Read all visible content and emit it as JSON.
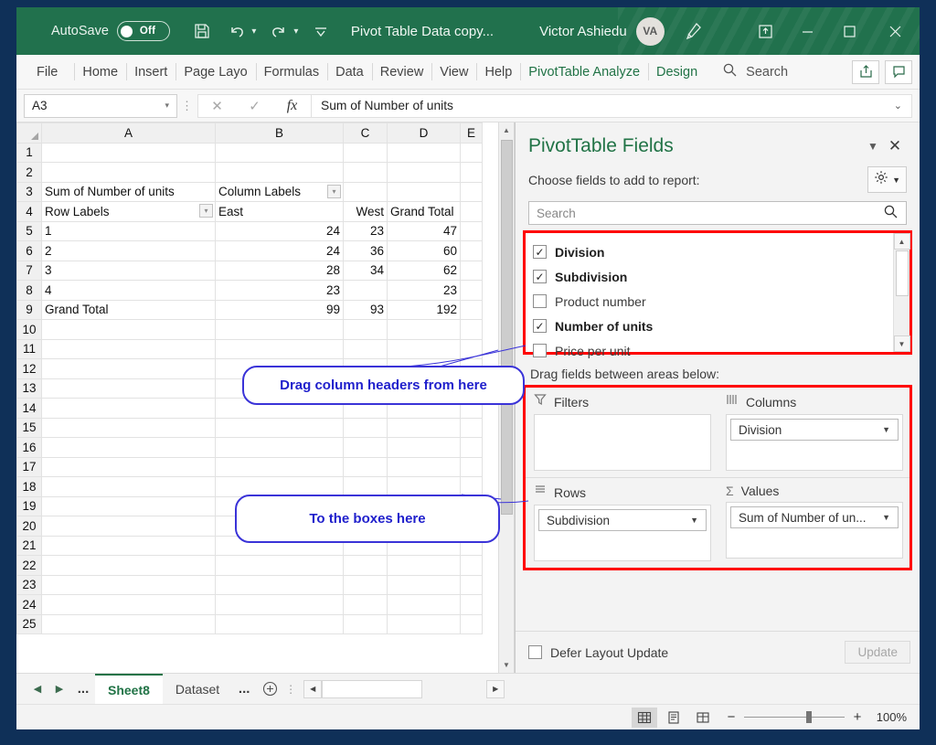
{
  "titlebar": {
    "autosave_label": "AutoSave",
    "autosave_state": "Off",
    "document_title": "Pivot Table Data copy...",
    "user_name": "Victor Ashiedu",
    "user_initials": "VA",
    "icons": [
      "save-icon",
      "undo-icon",
      "redo-icon",
      "customize-quick-access-icon",
      "pen-icon",
      "restore-down-window-icon"
    ],
    "window_buttons": [
      "minimize",
      "maximize",
      "close"
    ],
    "bg_color": "#21714d"
  },
  "ribbon": {
    "tabs": [
      {
        "label": "File",
        "contextual": false
      },
      {
        "label": "Home",
        "contextual": false
      },
      {
        "label": "Insert",
        "contextual": false
      },
      {
        "label": "Page Layo",
        "contextual": false
      },
      {
        "label": "Formulas",
        "contextual": false
      },
      {
        "label": "Data",
        "contextual": false
      },
      {
        "label": "Review",
        "contextual": false
      },
      {
        "label": "View",
        "contextual": false
      },
      {
        "label": "Help",
        "contextual": false
      },
      {
        "label": "PivotTable Analyze",
        "contextual": true
      },
      {
        "label": "Design",
        "contextual": true
      }
    ],
    "search_label": "Search",
    "share_icon": "share-icon",
    "comments_icon": "comments-icon",
    "contextual_color": "#217346"
  },
  "formula_bar": {
    "name_box_value": "A3",
    "cancel_icon": "cancel-x-icon",
    "enter_icon": "enter-check-icon",
    "function_icon": "fx-icon",
    "formula_value": "Sum of Number of units"
  },
  "grid": {
    "column_headers": [
      "A",
      "B",
      "C",
      "D",
      "E"
    ],
    "row_numbers": [
      1,
      2,
      3,
      4,
      5,
      6,
      7,
      8,
      9,
      10,
      11,
      12,
      13,
      14,
      15,
      16,
      17,
      18,
      19,
      20,
      21,
      22,
      23,
      24,
      25
    ],
    "cells": {
      "A3": "Sum of Number of units",
      "B3": "Column Labels",
      "A4": "Row Labels",
      "B4": "East",
      "C4": "West",
      "D4": "Grand Total",
      "rows": [
        {
          "label": "1",
          "east": "24",
          "west": "23",
          "total": "47"
        },
        {
          "label": "2",
          "east": "24",
          "west": "36",
          "total": "60"
        },
        {
          "label": "3",
          "east": "28",
          "west": "34",
          "total": "62"
        },
        {
          "label": "4",
          "east": "23",
          "west": "",
          "total": "23"
        },
        {
          "label": "Grand Total",
          "east": "99",
          "west": "93",
          "total": "192"
        }
      ]
    }
  },
  "callouts": [
    {
      "text": "Drag column headers from here"
    },
    {
      "text": "To the boxes here"
    }
  ],
  "pivot_pane": {
    "title": "PivotTable Fields",
    "menu_icon": "chevron-down-icon",
    "close_icon": "close-icon",
    "choose_label": "Choose fields to add to report:",
    "tools_icon": "gear-icon",
    "search_placeholder": "Search",
    "search_icon": "search-icon",
    "fields": [
      {
        "label": "Division",
        "checked": true
      },
      {
        "label": "Subdivision",
        "checked": true
      },
      {
        "label": "Product number",
        "checked": false
      },
      {
        "label": "Number of units",
        "checked": true
      },
      {
        "label": "Price per unit",
        "checked": false
      }
    ],
    "drag_hint": "Drag fields between areas below:",
    "areas": [
      {
        "name": "Filters",
        "icon": "filter-icon",
        "chips": []
      },
      {
        "name": "Columns",
        "icon": "columns-icon",
        "chips": [
          "Division"
        ]
      },
      {
        "name": "Rows",
        "icon": "rows-icon",
        "chips": [
          "Subdivision"
        ]
      },
      {
        "name": "Values",
        "icon": "sigma-icon",
        "chips": [
          "Sum of Number of un..."
        ]
      }
    ],
    "defer_label": "Defer Layout Update",
    "defer_checked": false,
    "update_button": "Update",
    "highlight_color": "#ff0000"
  },
  "sheet_tabs": {
    "nav_prev_icon": "triangle-left-icon",
    "nav_next_icon": "triangle-right-icon",
    "overflow_dots": "...",
    "tabs": [
      {
        "label": "Sheet8",
        "active": true
      },
      {
        "label": "Dataset",
        "active": false
      }
    ],
    "more_dots": "...",
    "add_sheet_icon": "plus-circle-icon"
  },
  "status_bar": {
    "view_buttons": [
      "normal-view-icon",
      "page-layout-icon",
      "page-break-preview-icon"
    ],
    "zoom_out_icon": "minus-icon",
    "zoom_in_icon": "plus-icon",
    "zoom_level": "100%"
  }
}
